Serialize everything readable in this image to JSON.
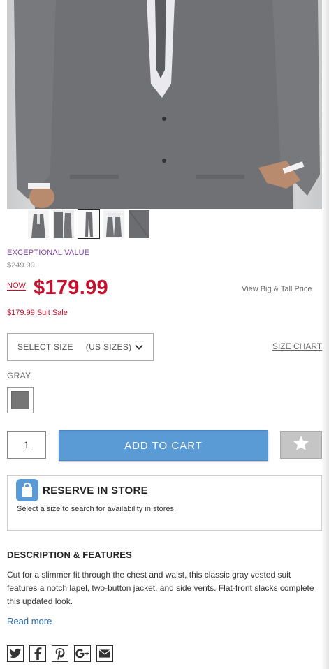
{
  "product": {
    "badge": "EXCEPTIONAL VALUE",
    "was_price": "$249.99",
    "now_label": "NOW",
    "now_price": "$179.99",
    "big_tall_link": "View Big & Tall Price",
    "promo_text": "$179.99 Suit Sale"
  },
  "size_selector": {
    "label": "SELECT SIZE",
    "units": "(US SIZES)",
    "size_chart_link": "SIZE CHART"
  },
  "color": {
    "label": "GRAY",
    "swatch_hex": "#767676"
  },
  "cart": {
    "quantity": "1",
    "add_label": "ADD TO CART"
  },
  "store": {
    "title": "RESERVE IN STORE",
    "subtitle": "Select a size to search for availability in stores."
  },
  "description": {
    "title": "DESCRIPTION & FEATURES",
    "body": "Cut for a slimmer fit through the chest and waist, this classic gray vested suit features a notch lapel, two-button jacket, and side vents. Flat-front slacks complete this updated look.",
    "read_more": "Read more"
  },
  "social_icons": [
    "twitter-icon",
    "facebook-icon",
    "pinterest-icon",
    "google-plus-icon",
    "email-icon"
  ],
  "thumbnails_count": 5,
  "colors": {
    "price_red": "#c8102e",
    "badge_purple": "#7b3fa0",
    "button_blue": "#5b9bd5",
    "link_blue": "#2b6cb0"
  }
}
